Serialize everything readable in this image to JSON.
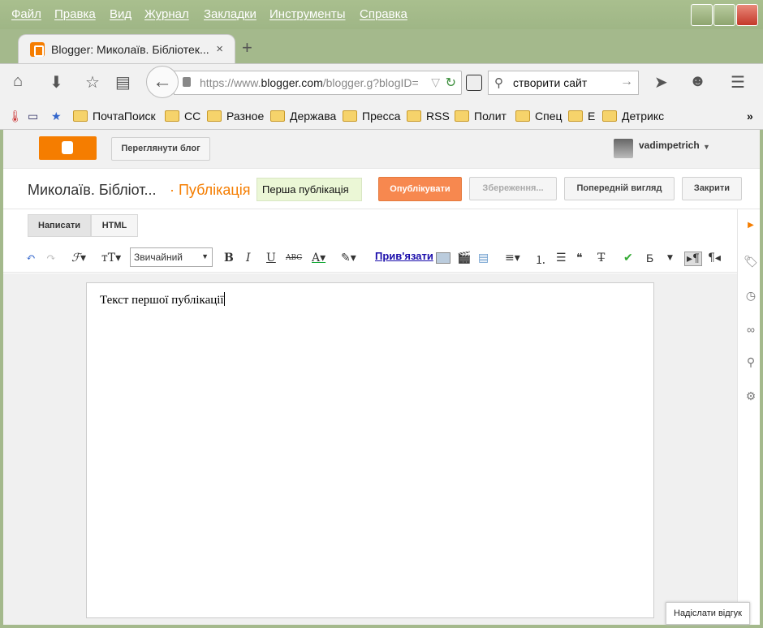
{
  "menu": {
    "items": [
      "Файл",
      "Правка",
      "Вид",
      "Журнал",
      "Закладки",
      "Инструменты",
      "Справка"
    ]
  },
  "tab": {
    "title": "Blogger: Миколаїв. Бібліотек...",
    "close": "×",
    "new": "+"
  },
  "nav": {
    "url_prefix": "https://www.",
    "url_host": "blogger.com",
    "url_path": "/blogger.g?blogID=",
    "search_value": "створити сайт"
  },
  "bookmarks": [
    "ПочтаПоиск",
    "СС",
    "Разное",
    "Держава",
    "Пресса",
    "RSS",
    "Полит",
    "Спец",
    "Е",
    "Детрикс"
  ],
  "bookmarks_more": "»",
  "blogger": {
    "view_blog": "Переглянути блог",
    "username": "vadimpetrich",
    "blog_name": "Миколаїв. Бібліот...",
    "section": "· Публікація",
    "post_title": "Перша публікація",
    "publish": "Опублікувати",
    "saving": "Збереження...",
    "preview": "Попередній вигляд",
    "close": "Закрити",
    "mode_compose": "Написати",
    "mode_html": "HTML",
    "font_select": "Звичайний",
    "link": "Прив'язати",
    "spell_lang": "Б",
    "body_text": "Текст першої публікації",
    "feedback": "Надіслати відгук"
  },
  "colors": {
    "accent": "#f57d00",
    "publish": "#f7884f",
    "chrome": "#a4b98c"
  }
}
